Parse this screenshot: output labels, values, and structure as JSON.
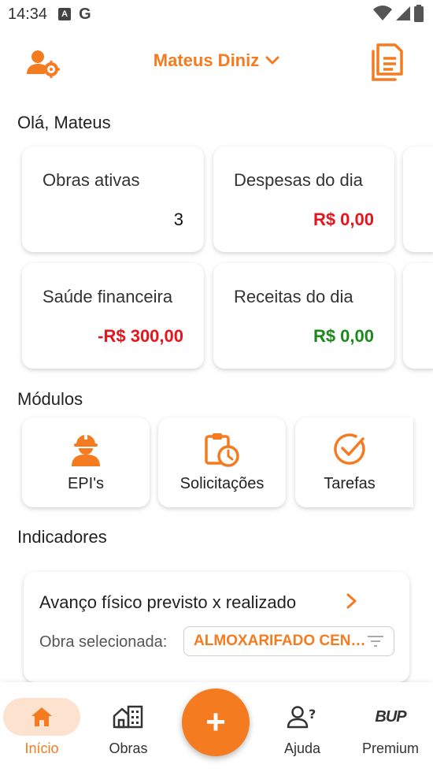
{
  "status_bar": {
    "time": "14:34",
    "icon_a_letter": "A",
    "icon_g_letter": "G"
  },
  "header": {
    "user_name": "Mateus Diniz"
  },
  "greeting": "Olá, Mateus",
  "stats": [
    {
      "label": "Obras ativas",
      "value": "3",
      "color": "#111111"
    },
    {
      "label": "Despesas do dia",
      "value": "R$ 0,00",
      "color": "#E8141B"
    },
    {
      "label": "Saúde financeira",
      "value": "-R$ 300,00",
      "color": "#E8141B"
    },
    {
      "label": "Receitas do dia",
      "value": "R$ 0,00",
      "color": "#1B8A1B"
    }
  ],
  "modules_title": "Módulos",
  "modules": [
    {
      "label": "EPI's",
      "icon": "worker-helmet-icon"
    },
    {
      "label": "Solicitações",
      "icon": "clipboard-clock-icon"
    },
    {
      "label": "Tarefas",
      "icon": "check-circle-icon"
    }
  ],
  "indicators_title": "Indicadores",
  "indicator": {
    "title": "Avanço físico previsto x realizado",
    "obra_label": "Obra selecionada:",
    "obra_value": "ALMOXARIFADO CENTRAL"
  },
  "bottom_nav": {
    "items": [
      {
        "label": "Início",
        "icon": "home-icon",
        "active": true
      },
      {
        "label": "Obras",
        "icon": "buildings-icon",
        "active": false
      },
      {
        "label": "Ajuda",
        "icon": "user-help-icon",
        "active": false
      },
      {
        "label": "Premium",
        "icon": "premium-logo-icon",
        "active": false
      }
    ],
    "fab_label": "+",
    "premium_logo_text": "BUP"
  },
  "colors": {
    "accent": "#F47B20",
    "negative": "#E8141B",
    "positive": "#1B8A1B",
    "active_pill": "#fde3cf"
  }
}
